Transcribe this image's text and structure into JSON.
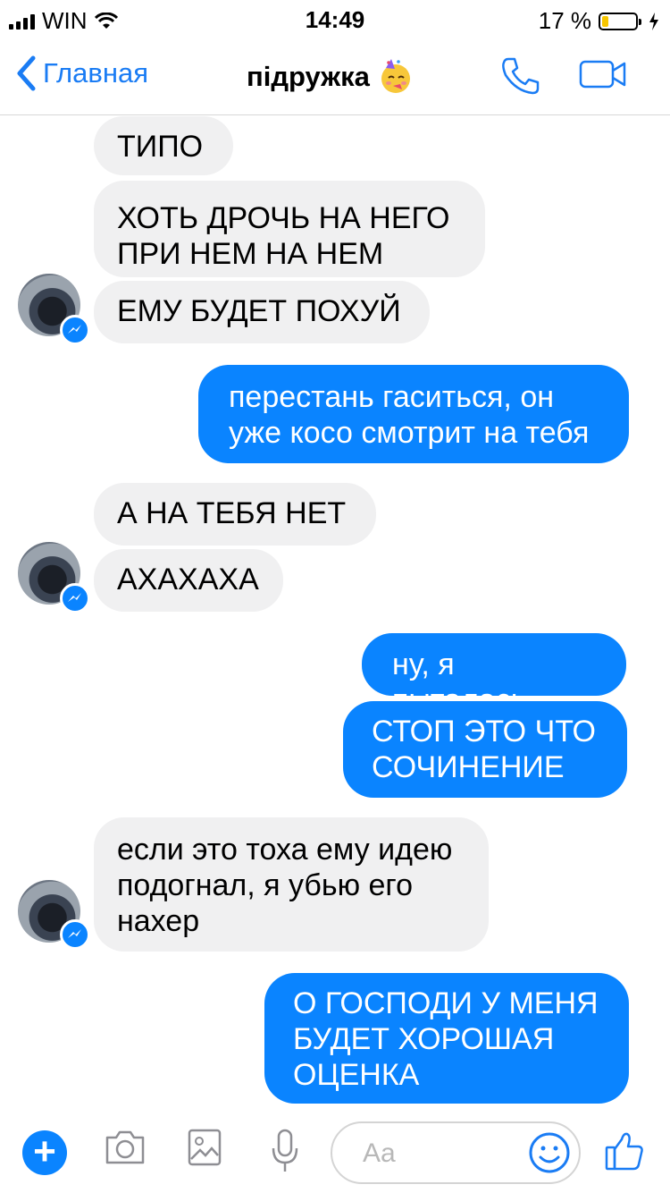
{
  "status_bar": {
    "carrier": "WIN",
    "time": "14:49",
    "battery_percent": "17 %"
  },
  "nav": {
    "back_label": "Главная",
    "title": "підружка",
    "accent_color": "#1a7cf4"
  },
  "messages": [
    {
      "side": "in",
      "text": "ТИПО"
    },
    {
      "side": "in",
      "lines": [
        "ХОТЬ ДРОЧЬ НА НЕГО",
        "ПРИ НЕМ НА НЕМ"
      ]
    },
    {
      "side": "in",
      "text": "ЕМУ БУДЕТ ПОХУЙ"
    },
    {
      "side": "out",
      "lines": [
        "перестань гаситься, он",
        "уже косо смотрит на тебя"
      ]
    },
    {
      "side": "in",
      "text": "А НА ТЕБЯ НЕТ"
    },
    {
      "side": "in",
      "text": "АХАХАХА"
    },
    {
      "side": "out",
      "text": "ну, я пыталась"
    },
    {
      "side": "out",
      "lines": [
        "СТОП ЭТО ЧТО",
        "СОЧИНЕНИЕ"
      ]
    },
    {
      "side": "in",
      "lines": [
        "если это тоха ему идею",
        "подогнал, я убью его",
        "нахер"
      ]
    },
    {
      "side": "out",
      "lines": [
        "О ГОСПОДИ У МЕНЯ",
        "БУДЕТ ХОРОШАЯ",
        "ОЦЕНКА"
      ]
    }
  ],
  "composer": {
    "placeholder": "Aa"
  },
  "icons": [
    "back-chevron-icon",
    "party-face-emoji-icon",
    "phone-icon",
    "video-camera-icon",
    "plus-icon",
    "camera-icon",
    "image-icon",
    "microphone-icon",
    "smiley-icon",
    "thumbs-up-icon",
    "messenger-badge-icon"
  ]
}
